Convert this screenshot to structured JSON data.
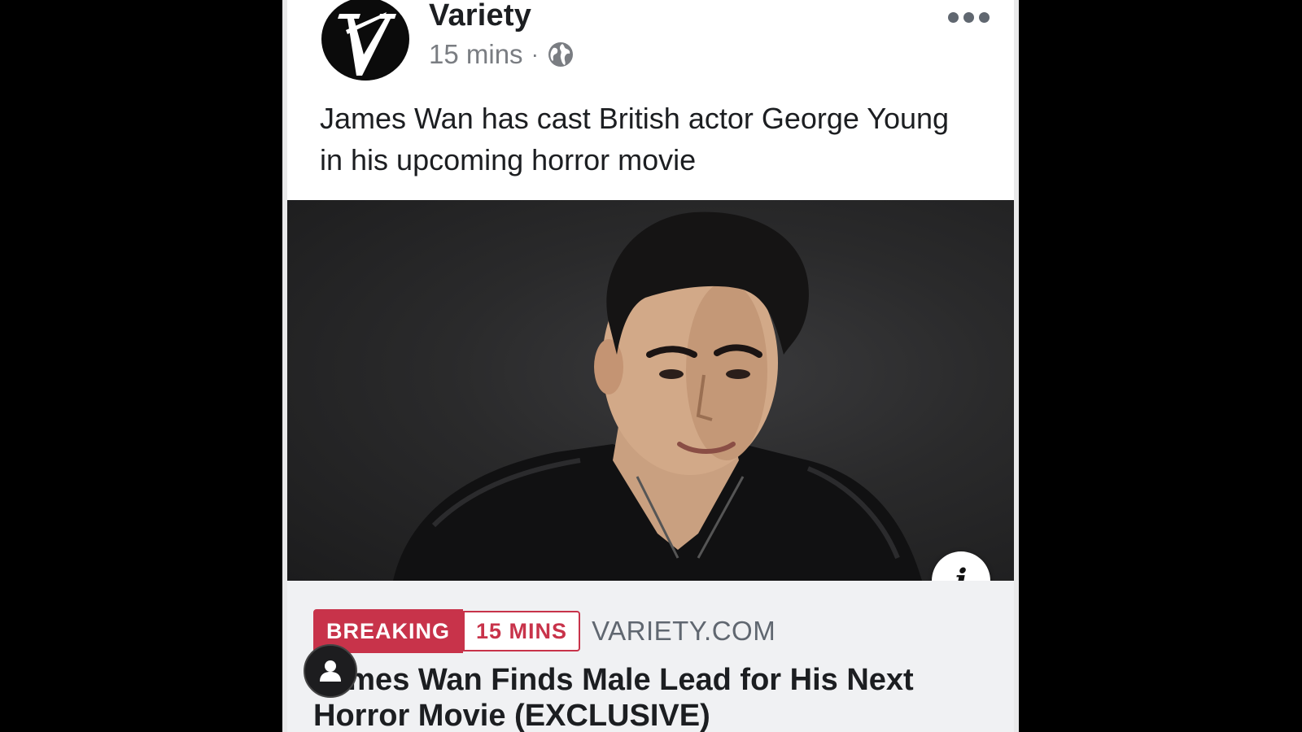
{
  "post": {
    "page_name": "Variety",
    "time": "15 mins",
    "separator": "·",
    "audience_icon": "globe-icon",
    "text": "James Wan has cast British actor George Young in his upcoming horror movie"
  },
  "link_preview": {
    "badge_label": "BREAKING",
    "badge_time": "15 MINS",
    "domain": "VARIETY.COM",
    "headline": "James Wan Finds Male Lead for His Next Horror Movie (EXCLUSIVE)"
  },
  "icons": {
    "more": "more-options-icon",
    "info": "info-icon",
    "profile": "person-icon",
    "avatar": "variety-logo"
  },
  "colors": {
    "breaking_red": "#c8334a",
    "text": "#1c1e21",
    "meta_gray": "#7a7d82",
    "preview_bg": "#f0f1f3"
  }
}
